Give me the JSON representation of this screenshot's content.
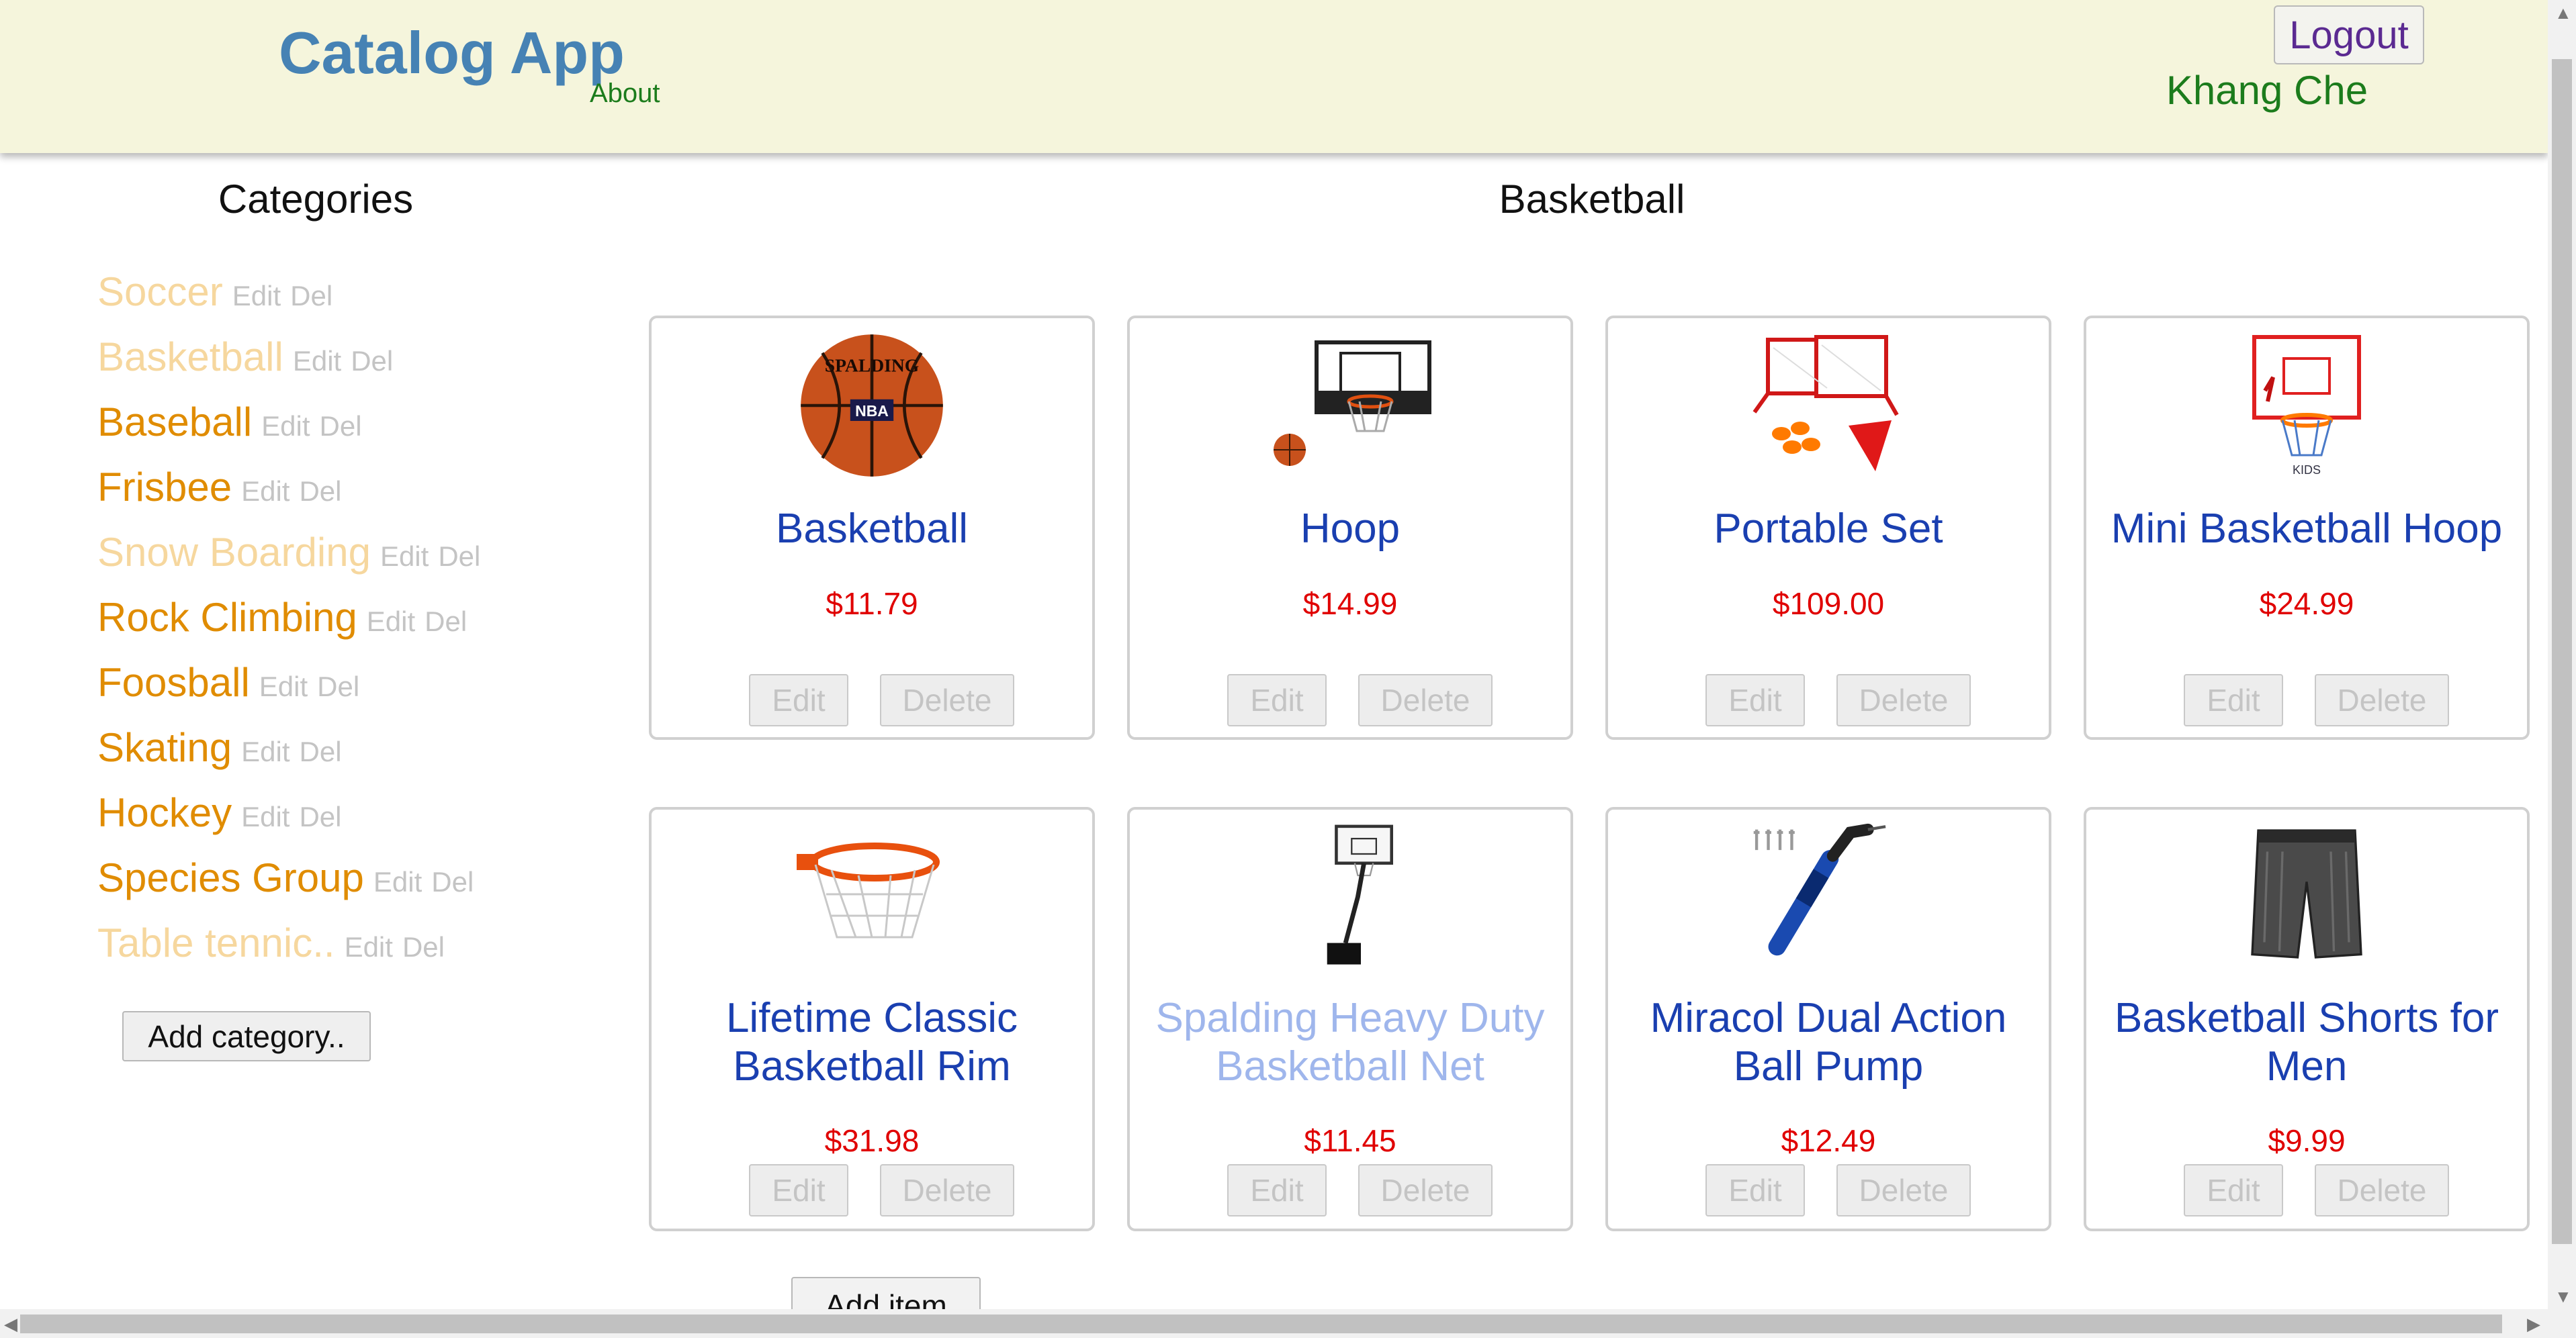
{
  "header": {
    "app_title": "Catalog App",
    "about": "About",
    "logout": "Logout",
    "username": "Khang Che"
  },
  "sidebar": {
    "title": "Categories",
    "edit_label": "Edit",
    "delete_label": "Del",
    "categories": [
      {
        "name": "Soccer",
        "faded": true
      },
      {
        "name": "Basketball",
        "faded": true
      },
      {
        "name": "Baseball",
        "faded": false
      },
      {
        "name": "Frisbee",
        "faded": false
      },
      {
        "name": "Snow Boarding",
        "faded": true
      },
      {
        "name": "Rock Climbing",
        "faded": false
      },
      {
        "name": "Foosball",
        "faded": false
      },
      {
        "name": "Skating",
        "faded": false
      },
      {
        "name": "Hockey",
        "faded": false
      },
      {
        "name": "Species Group",
        "faded": false
      },
      {
        "name": "Table tennic..",
        "faded": true
      }
    ],
    "add_category": "Add category.."
  },
  "main": {
    "title": "Basketball",
    "edit_label": "Edit",
    "delete_label": "Delete",
    "items": [
      {
        "name": "Basketball",
        "price": "$11.79",
        "image": "basketball-image",
        "faded": false
      },
      {
        "name": "Hoop",
        "price": "$14.99",
        "image": "hoop-image",
        "faded": false
      },
      {
        "name": "Portable Set",
        "price": "$109.00",
        "image": "portable-set-image",
        "faded": false
      },
      {
        "name": "Mini Basketball Hoop",
        "price": "$24.99",
        "image": "mini-hoop-image",
        "faded": false
      },
      {
        "name": "Lifetime Classic Basketball Rim",
        "price": "$31.98",
        "image": "rim-image",
        "faded": false
      },
      {
        "name": "Spalding Heavy Duty Basketball Net",
        "price": "$11.45",
        "image": "hoop-stand-image",
        "faded": true
      },
      {
        "name": "Miracol Dual Action Ball Pump",
        "price": "$12.49",
        "image": "ball-pump-image",
        "faded": false
      },
      {
        "name": "Basketball Shorts for Men",
        "price": "$9.99",
        "image": "shorts-image",
        "faded": false
      }
    ],
    "add_item": "Add item"
  },
  "colors": {
    "header_bg": "#f5f5dc",
    "title_blue": "#4682b4",
    "category_orange": "#e08c00",
    "item_name_blue": "#1a3fb0",
    "price_red": "#e00000",
    "user_green": "#1c7c1c"
  }
}
